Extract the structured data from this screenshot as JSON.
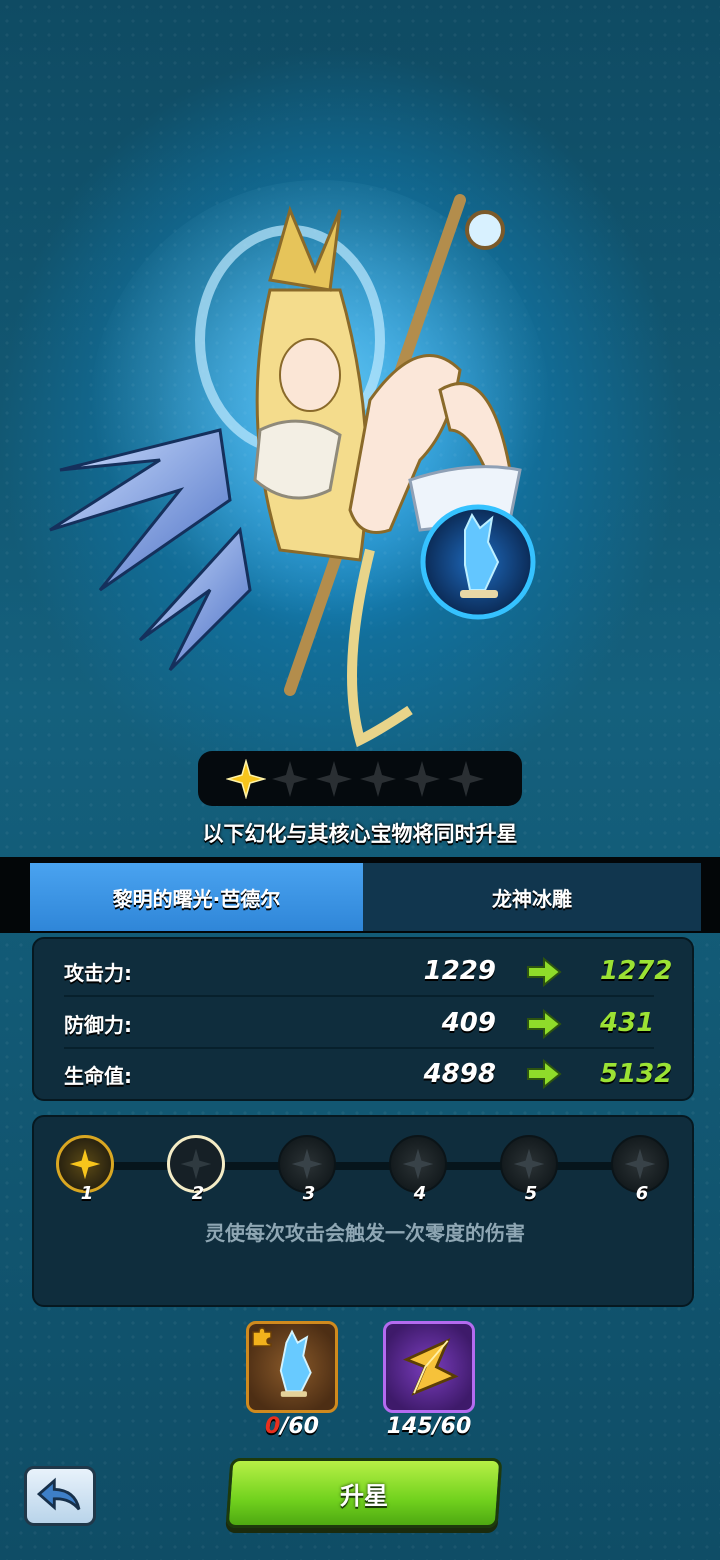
{
  "stars": {
    "total": 6,
    "filled": 1
  },
  "hint_text": "以下幻化与其核心宝物将同时升星",
  "tabs": [
    {
      "label": "黎明的曙光·芭德尔",
      "active": true
    },
    {
      "label": "龙神冰雕",
      "active": false
    }
  ],
  "stats": [
    {
      "label": "攻击力:",
      "old": "1229",
      "new": "1272"
    },
    {
      "label": "防御力:",
      "old": "409",
      "new": "431"
    },
    {
      "label": "生命值:",
      "old": "4898",
      "new": "5132"
    }
  ],
  "levels": {
    "nodes": [
      "1",
      "2",
      "3",
      "4",
      "5",
      "6"
    ],
    "current": 1,
    "description": "灵使每次攻击会触发一次零度的伤害"
  },
  "costs": {
    "fragment": {
      "have": "0",
      "need": "/60",
      "icon": "ice-statue-fragment-icon"
    },
    "star_stone": {
      "text": "145/60",
      "icon": "gold-star-stone-icon"
    }
  },
  "buttons": {
    "upgrade": "升星",
    "back_icon": "back-arrow-icon"
  },
  "colors": {
    "accent_green": "#9be234",
    "tab_active": "#3f96e6",
    "gold": "#d9a722",
    "red": "#e8301e"
  }
}
